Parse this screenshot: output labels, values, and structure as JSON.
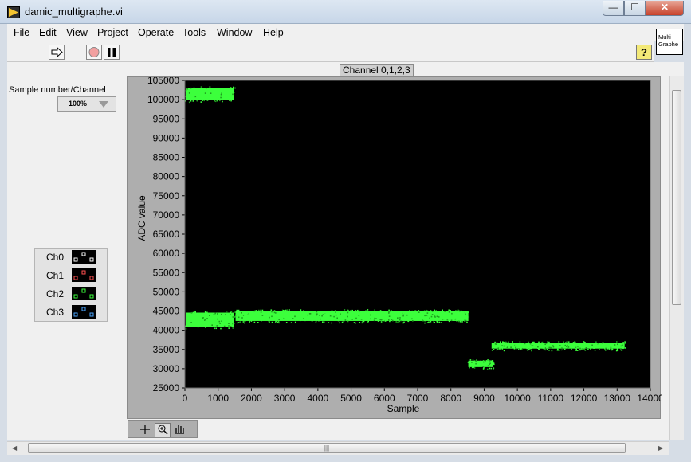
{
  "window": {
    "title": "damic_multigraphe.vi",
    "minimize": "—",
    "maximize": "☐",
    "close": "✕"
  },
  "menu": [
    "File",
    "Edit",
    "View",
    "Project",
    "Operate",
    "Tools",
    "Window",
    "Help"
  ],
  "toolbar": {
    "run_icon": "run-arrow-icon",
    "abort_icon": "abort-stop-icon",
    "pause_icon": "pause-icon",
    "help_label": "?"
  },
  "vi_icon": {
    "line1": "Multi",
    "line2": "Graphe"
  },
  "controls": {
    "sample_label": "Sample number/Channel",
    "sample_value": "100%"
  },
  "legend": {
    "items": [
      {
        "label": "Ch0",
        "color": "#ffffff"
      },
      {
        "label": "Ch1",
        "color": "#ff5050"
      },
      {
        "label": "Ch2",
        "color": "#3cff3c"
      },
      {
        "label": "Ch3",
        "color": "#4aa6ff"
      }
    ]
  },
  "palette": [
    "cursor-cross-icon",
    "zoom-icon",
    "pan-hand-icon"
  ],
  "chart_data": {
    "type": "scatter",
    "title": "Channel 0,1,2,3",
    "xlabel": "Sample",
    "ylabel": "ADC value",
    "xlim": [
      0,
      14000
    ],
    "ylim": [
      25000,
      105000
    ],
    "x_ticks": [
      0,
      1000,
      2000,
      3000,
      4000,
      5000,
      6000,
      7000,
      8000,
      9000,
      10000,
      11000,
      12000,
      13000,
      14000
    ],
    "y_ticks": [
      25000,
      30000,
      35000,
      40000,
      45000,
      50000,
      55000,
      60000,
      65000,
      70000,
      75000,
      80000,
      85000,
      90000,
      95000,
      100000,
      105000
    ],
    "grid": false,
    "plot_color": "#3cff3c",
    "background": "#000000",
    "series": [
      {
        "segments": [
          {
            "x_range": [
              0,
              1500
            ],
            "y_range": [
              99500,
              103500
            ]
          },
          {
            "x_range": [
              0,
              1500
            ],
            "y_range": [
              40500,
              45000
            ]
          },
          {
            "x_range": [
              1500,
              8550
            ],
            "y_range": [
              42000,
              45500
            ]
          },
          {
            "x_range": [
              8500,
              9300
            ],
            "y_range": [
              30000,
              32500
            ]
          },
          {
            "x_range": [
              9200,
              13250
            ],
            "y_range": [
              34800,
              37200
            ]
          }
        ]
      }
    ]
  }
}
